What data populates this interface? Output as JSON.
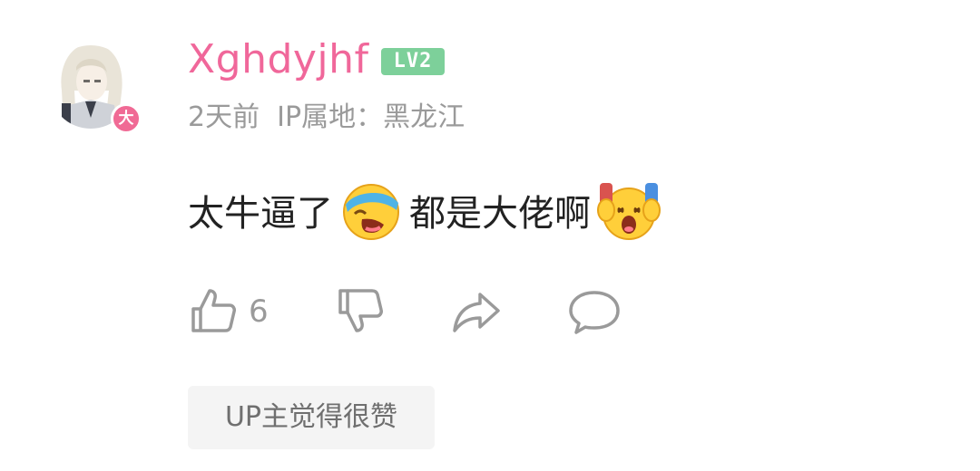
{
  "comment": {
    "username": "Xghdyjhf",
    "level_badge": "LV2",
    "avatar_badge": "大",
    "time": "2天前",
    "ip_location": "IP属地：黑龙江",
    "text_part1": "太牛逼了",
    "emoji1": "laughing-tears-emoji",
    "text_part2": "都是大佬啊",
    "emoji2": "shocked-screaming-emoji",
    "like_count": "6",
    "up_tag": "UP主觉得很赞"
  },
  "colors": {
    "username": "#f0679a",
    "level_badge": "#7dd09a",
    "meta_text": "#9a9a9a",
    "icon_stroke": "#9a9a9a",
    "tag_bg": "#f4f4f4"
  }
}
